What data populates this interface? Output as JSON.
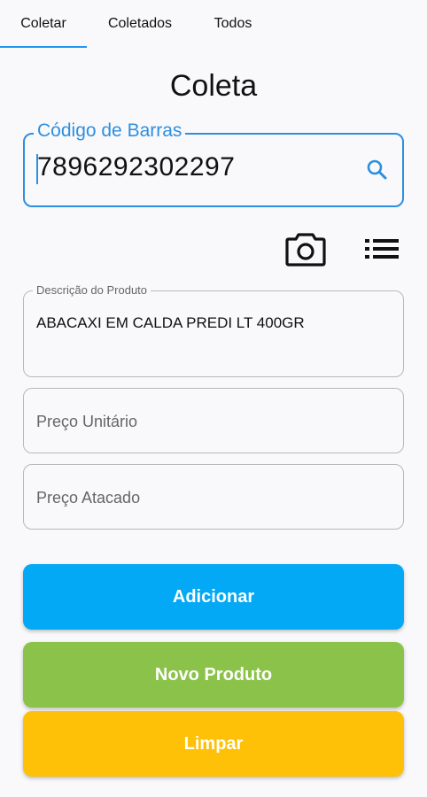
{
  "tabs": [
    {
      "label": "Coletar",
      "active": true
    },
    {
      "label": "Coletados",
      "active": false
    },
    {
      "label": "Todos",
      "active": false
    }
  ],
  "page": {
    "title": "Coleta"
  },
  "barcode": {
    "label": "Código de Barras",
    "value": "7896292302297",
    "icon": "search-icon"
  },
  "actions": {
    "camera_icon": "camera-icon",
    "list_icon": "list-icon"
  },
  "description": {
    "label": "Descrição do Produto",
    "value": "ABACAXI EM CALDA PREDI LT 400GR"
  },
  "unit_price": {
    "placeholder": "Preço Unitário",
    "value": ""
  },
  "wholesale_price": {
    "placeholder": "Preço Atacado",
    "value": ""
  },
  "buttons": {
    "add": {
      "label": "Adicionar",
      "color": "#03a9f4"
    },
    "new_product": {
      "label": "Novo Produto",
      "color": "#8bc34a"
    },
    "clear": {
      "label": "Limpar",
      "color": "#ffc107"
    }
  },
  "colors": {
    "accent": "#2e8fe0"
  }
}
